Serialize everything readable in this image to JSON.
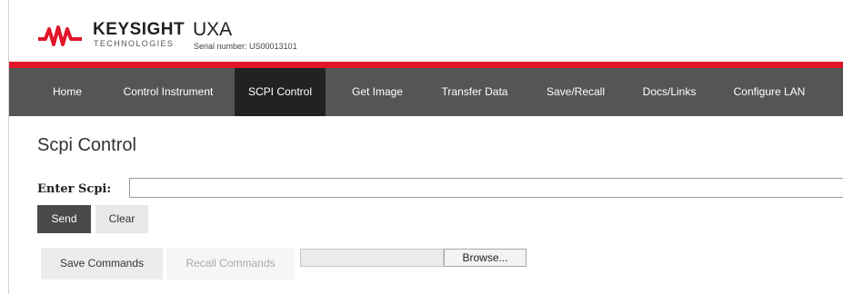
{
  "header": {
    "brand_name": "KEYSIGHT",
    "brand_sub": "TECHNOLOGIES",
    "model": "UXA",
    "serial": "Serial number: US00013101",
    "brand_color": "#e1152a"
  },
  "nav": {
    "items": [
      {
        "label": "Home"
      },
      {
        "label": "Control Instrument"
      },
      {
        "label": "SCPI Control",
        "active": true
      },
      {
        "label": "Get Image"
      },
      {
        "label": "Transfer Data"
      },
      {
        "label": "Save/Recall"
      },
      {
        "label": "Docs/Links"
      },
      {
        "label": "Configure LAN"
      }
    ],
    "background": "#555555",
    "active_background": "#222222"
  },
  "main": {
    "title": "Scpi Control",
    "enter_label": "Enter Scpi:",
    "scpi_value": "",
    "send_label": "Send",
    "clear_label": "Clear",
    "save_commands_label": "Save Commands",
    "recall_commands_label": "Recall Commands",
    "browse_label": "Browse..."
  }
}
